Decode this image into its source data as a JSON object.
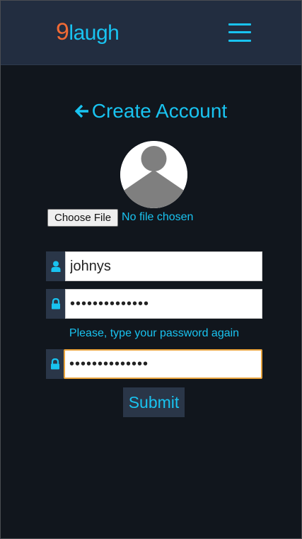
{
  "header": {
    "brand_number": "9",
    "brand_text": "laugh",
    "menu_icon": "hamburger-menu-icon"
  },
  "page": {
    "title": "Create Account",
    "back_icon": "arrow-left-icon"
  },
  "avatar": {
    "icon": "default-user-avatar-icon"
  },
  "file_input": {
    "button_label": "Choose File",
    "status": "No file chosen"
  },
  "form": {
    "username": {
      "value": "johnys",
      "icon": "user-icon"
    },
    "password": {
      "value": "••••••••••••••",
      "icon": "lock-icon"
    },
    "confirm_hint": "Please, type your password again",
    "confirm_password": {
      "value": "••••••••••••••",
      "icon": "lock-icon"
    },
    "submit_label": "Submit"
  },
  "colors": {
    "background": "#11161d",
    "navbar": "#222d40",
    "accent": "#19c3f0",
    "brand_number": "#f06a35",
    "addon": "#2a3648",
    "focus_border": "#e8a33d"
  }
}
